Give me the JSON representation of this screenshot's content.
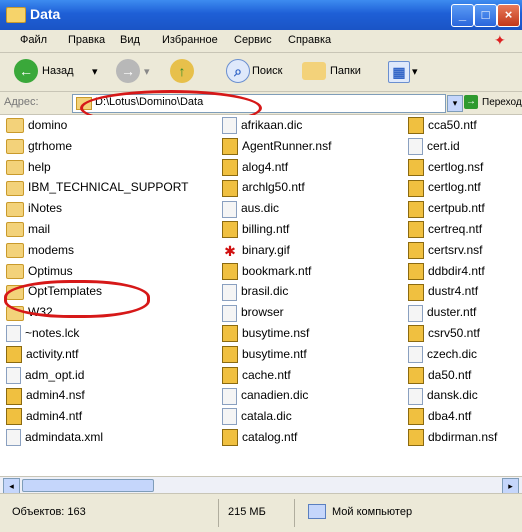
{
  "window": {
    "title": "Data"
  },
  "menu": [
    "Файл",
    "Правка",
    "Вид",
    "Избранное",
    "Сервис",
    "Справка"
  ],
  "toolbar": {
    "back": "Назад",
    "search": "Поиск",
    "folders": "Папки"
  },
  "address": {
    "label": "Адрес:",
    "value": "D:\\Lotus\\Domino\\Data",
    "go": "Переход"
  },
  "columns": [
    [
      {
        "name": "domino",
        "icon": "folder"
      },
      {
        "name": "gtrhome",
        "icon": "folder"
      },
      {
        "name": "help",
        "icon": "folder"
      },
      {
        "name": "IBM_TECHNICAL_SUPPORT",
        "icon": "folder"
      },
      {
        "name": "iNotes",
        "icon": "folder"
      },
      {
        "name": "mail",
        "icon": "folder"
      },
      {
        "name": "modems",
        "icon": "folder"
      },
      {
        "name": "Optimus",
        "icon": "folder"
      },
      {
        "name": "OptTemplates",
        "icon": "folder"
      },
      {
        "name": "W32",
        "icon": "folder"
      },
      {
        "name": "~notes.lck",
        "icon": "file"
      },
      {
        "name": "activity.ntf",
        "icon": "notes"
      },
      {
        "name": "adm_opt.id",
        "icon": "file"
      },
      {
        "name": "admin4.nsf",
        "icon": "notes"
      },
      {
        "name": "admin4.ntf",
        "icon": "notes"
      },
      {
        "name": "admindata.xml",
        "icon": "file"
      }
    ],
    [
      {
        "name": "afrikaan.dic",
        "icon": "file"
      },
      {
        "name": "AgentRunner.nsf",
        "icon": "notes"
      },
      {
        "name": "alog4.ntf",
        "icon": "notes"
      },
      {
        "name": "archlg50.ntf",
        "icon": "notes"
      },
      {
        "name": "aus.dic",
        "icon": "file"
      },
      {
        "name": "billing.ntf",
        "icon": "notes"
      },
      {
        "name": "binary.gif",
        "icon": "gif"
      },
      {
        "name": "bookmark.ntf",
        "icon": "notes"
      },
      {
        "name": "brasil.dic",
        "icon": "file"
      },
      {
        "name": "browser",
        "icon": "file"
      },
      {
        "name": "busytime.nsf",
        "icon": "notes"
      },
      {
        "name": "busytime.ntf",
        "icon": "notes"
      },
      {
        "name": "cache.ntf",
        "icon": "notes"
      },
      {
        "name": "canadien.dic",
        "icon": "file"
      },
      {
        "name": "catala.dic",
        "icon": "file"
      },
      {
        "name": "catalog.ntf",
        "icon": "notes"
      }
    ],
    [
      {
        "name": "cca50.ntf",
        "icon": "notes"
      },
      {
        "name": "cert.id",
        "icon": "file"
      },
      {
        "name": "certlog.nsf",
        "icon": "notes"
      },
      {
        "name": "certlog.ntf",
        "icon": "notes"
      },
      {
        "name": "certpub.ntf",
        "icon": "notes"
      },
      {
        "name": "certreq.ntf",
        "icon": "notes"
      },
      {
        "name": "certsrv.nsf",
        "icon": "notes"
      },
      {
        "name": "ddbdir4.ntf",
        "icon": "notes"
      },
      {
        "name": "dustr4.ntf",
        "icon": "notes"
      },
      {
        "name": "duster.ntf",
        "icon": "file"
      },
      {
        "name": "csrv50.ntf",
        "icon": "notes"
      },
      {
        "name": "czech.dic",
        "icon": "file"
      },
      {
        "name": "da50.ntf",
        "icon": "notes"
      },
      {
        "name": "dansk.dic",
        "icon": "file"
      },
      {
        "name": "dba4.ntf",
        "icon": "notes"
      },
      {
        "name": "dbdirman.nsf",
        "icon": "notes"
      }
    ]
  ],
  "status": {
    "objects": "Объектов: 163",
    "size": "215 МБ",
    "location": "Мой компьютер"
  }
}
